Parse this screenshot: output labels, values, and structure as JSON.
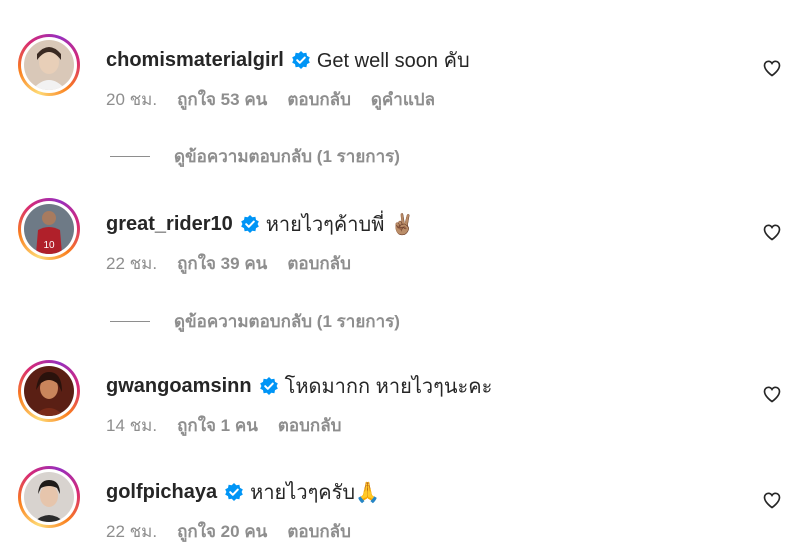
{
  "comments": [
    {
      "username": "chomismaterialgirl",
      "text": "Get well soon คับ",
      "time": "20 ชม.",
      "likes": "ถูกใจ 53 คน",
      "reply": "ตอบกลับ",
      "translate": "ดูคำแปล",
      "view_replies": "ดูข้อความตอบกลับ (1 รายการ)"
    },
    {
      "username": "great_rider10",
      "text": "หายไวๆค้าบพี่ ✌🏽",
      "time": "22 ชม.",
      "likes": "ถูกใจ 39 คน",
      "reply": "ตอบกลับ",
      "view_replies": "ดูข้อความตอบกลับ (1 รายการ)"
    },
    {
      "username": "gwangoamsinn",
      "text": "โหดมากก หายไวๆนะคะ",
      "time": "14 ชม.",
      "likes": "ถูกใจ 1 คน",
      "reply": "ตอบกลับ"
    },
    {
      "username": "golfpichaya",
      "text": "หายไวๆครับ🙏",
      "time": "22 ชม.",
      "likes": "ถูกใจ 20 คน",
      "reply": "ตอบกลับ"
    }
  ],
  "colors": {
    "verified": "#0095f6",
    "muted": "#8e8e8e",
    "text": "#262626"
  },
  "icons": {
    "verified": "verified-badge-icon",
    "like": "heart-outline-icon"
  }
}
